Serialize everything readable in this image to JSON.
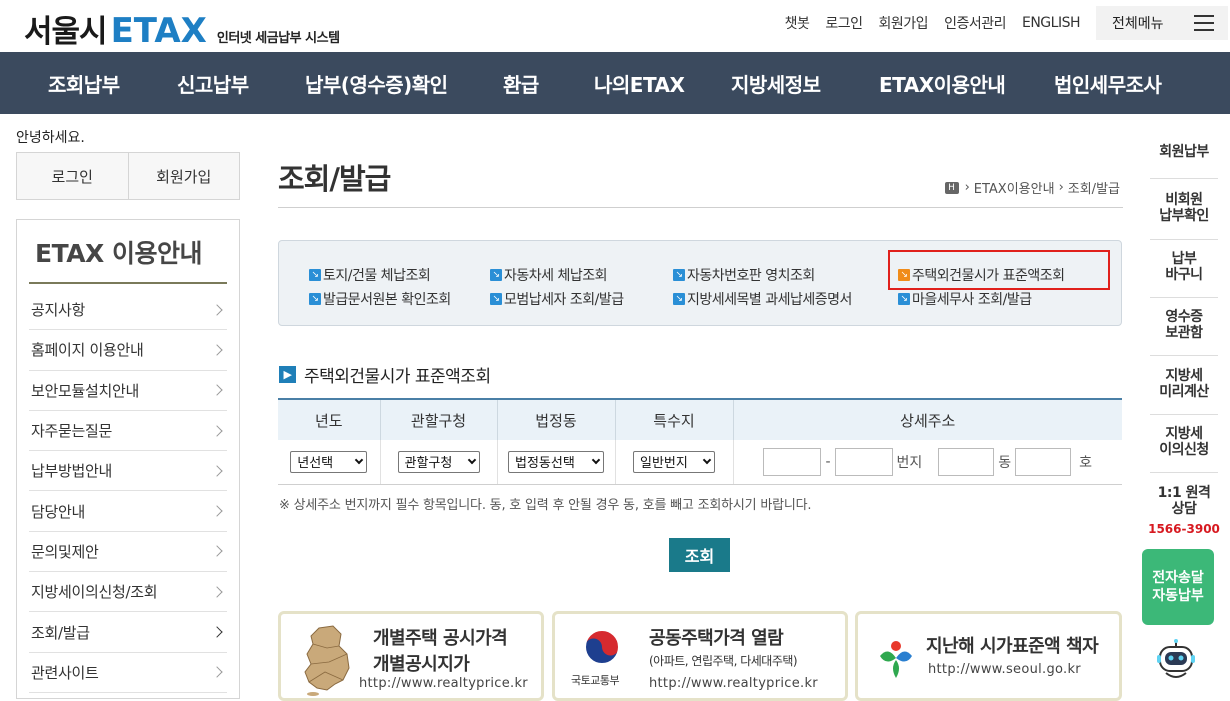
{
  "header": {
    "logo_city": "서울시",
    "logo_etax": "ETAX",
    "logo_sub": "인터넷 세금납부 시스템",
    "util": [
      "챗봇",
      "로그인",
      "회원가입",
      "인증서관리",
      "ENGLISH"
    ],
    "all_menu": "전체메뉴"
  },
  "gnb": [
    "조회납부",
    "신고납부",
    "납부(영수증)확인",
    "환급",
    "나의ETAX",
    "지방세정보",
    "ETAX이용안내",
    "법인세무조사"
  ],
  "left": {
    "greeting": "안녕하세요.",
    "login": "로그인",
    "join": "회원가입",
    "lnb_title": "ETAX 이용안내",
    "items": [
      "공지사항",
      "홈페이지 이용안내",
      "보안모듈설치안내",
      "자주묻는질문",
      "납부방법안내",
      "담당안내",
      "문의및제안",
      "지방세이의신청/조회",
      "조회/발급",
      "관련사이트"
    ]
  },
  "content": {
    "title": "조회/발급",
    "breadcrumb": [
      "H",
      "ETAX이용안내",
      "조회/발급"
    ],
    "links": [
      {
        "label": "토지/건물 체납조회"
      },
      {
        "label": "자동차세 체납조회"
      },
      {
        "label": "자동차번호판 영치조회"
      },
      {
        "label": "주택외건물시가 표준액조회"
      },
      {
        "label": "발급문서원본 확인조회"
      },
      {
        "label": "모범납세자 조회/발급"
      },
      {
        "label": "지방세세목별 과세납세증명서"
      },
      {
        "label": "마을세무사 조회/발급"
      }
    ],
    "section_title": "주택외건물시가 표준액조회",
    "table_headers": [
      "년도",
      "관할구청",
      "법정동",
      "특수지",
      "상세주소"
    ],
    "selects": {
      "year": "년선택",
      "district": "관할구청",
      "dong": "법정동선택",
      "special": "일반번지"
    },
    "addr_labels": {
      "dash": "-",
      "bunji": "번지",
      "dong": "동",
      "ho": "호"
    },
    "note": "※ 상세주소 번지까지 필수 항목입니다. 동, 호 입력 후 안될 경우 동, 호를 빼고 조회하시기 바랍니다.",
    "search_button": "조회"
  },
  "banners": [
    {
      "t1": "개별주택 공시가격",
      "t2": "개별공시지가",
      "url": "http://www.realtyprice.kr"
    },
    {
      "t1": "공동주택가격 열람",
      "t2": "(아파트, 연립주택, 다세대주택)",
      "url": "http://www.realtyprice.kr",
      "logo_text": "국토교통부"
    },
    {
      "t1": "지난해 시가표준액 책자",
      "url": "http://www.seoul.go.kr"
    }
  ],
  "quick": {
    "items": [
      "회원납부",
      "비회원\n납부확인",
      "납부\n바구니",
      "영수증\n보관함",
      "지방세\n미리계산",
      "지방세\n이의신청",
      "1:1 원격\n상담"
    ],
    "tel": "1566-3900",
    "green": "전자송달\n자동납부"
  }
}
